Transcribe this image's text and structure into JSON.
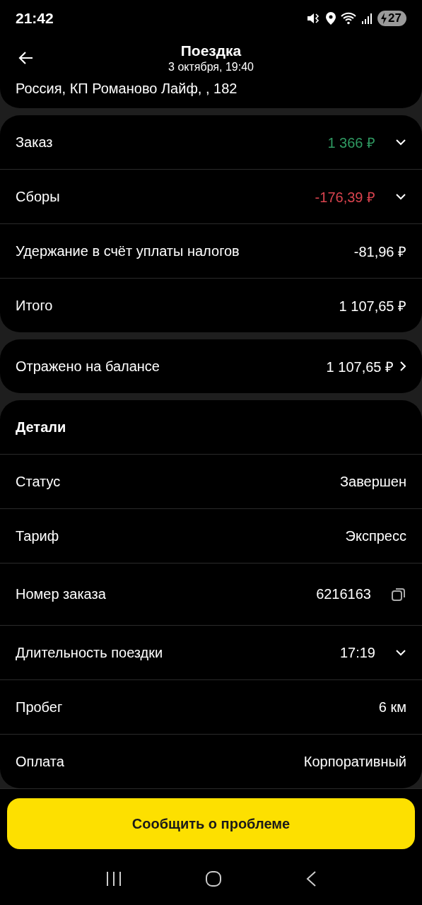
{
  "status_bar": {
    "time": "21:42",
    "battery": "27"
  },
  "header": {
    "title": "Поездка",
    "subtitle": "3 октября, 19:40",
    "address": "Россия, КП Романово Лайф, , 182"
  },
  "sections": [
    {
      "rows": [
        {
          "label": "Заказ",
          "value": "1 366 ₽",
          "color": "#2f9a62",
          "kind": "expandable",
          "expanded": false
        },
        {
          "label": "Сборы",
          "value": "-176,39 ₽",
          "color": "#d9434e",
          "kind": "expandable",
          "expanded": false
        },
        {
          "label": "Удержание в счёт уплаты налогов",
          "value": "-81,96 ₽",
          "color": "#ffffff",
          "kind": "plain"
        },
        {
          "label": "Итого",
          "value": "1 107,65 ₽",
          "color": "#ffffff",
          "kind": "plain"
        }
      ]
    },
    {
      "rows": [
        {
          "label": "Отражено на балансе",
          "value": "1 107,65 ₽",
          "color": "#ffffff",
          "kind": "link"
        }
      ]
    },
    {
      "heading": "Детали",
      "rows": [
        {
          "label": "Статус",
          "value": "Завершен",
          "color": "#ffffff",
          "kind": "plain"
        },
        {
          "label": "Тариф",
          "value": "Экспресс",
          "color": "#ffffff",
          "kind": "plain"
        },
        {
          "label": "Номер заказа",
          "value": "6216163",
          "color": "#ffffff",
          "kind": "copy"
        },
        {
          "label": "Длительность поездки",
          "value": "17:19",
          "color": "#ffffff",
          "kind": "expandable",
          "expanded": false
        },
        {
          "label": "Пробег",
          "value": "6 км",
          "color": "#ffffff",
          "kind": "plain"
        },
        {
          "label": "Оплата",
          "value": "Корпоративный",
          "color": "#ffffff",
          "kind": "plain"
        }
      ]
    }
  ],
  "action_button": "Сообщить о проблеме"
}
